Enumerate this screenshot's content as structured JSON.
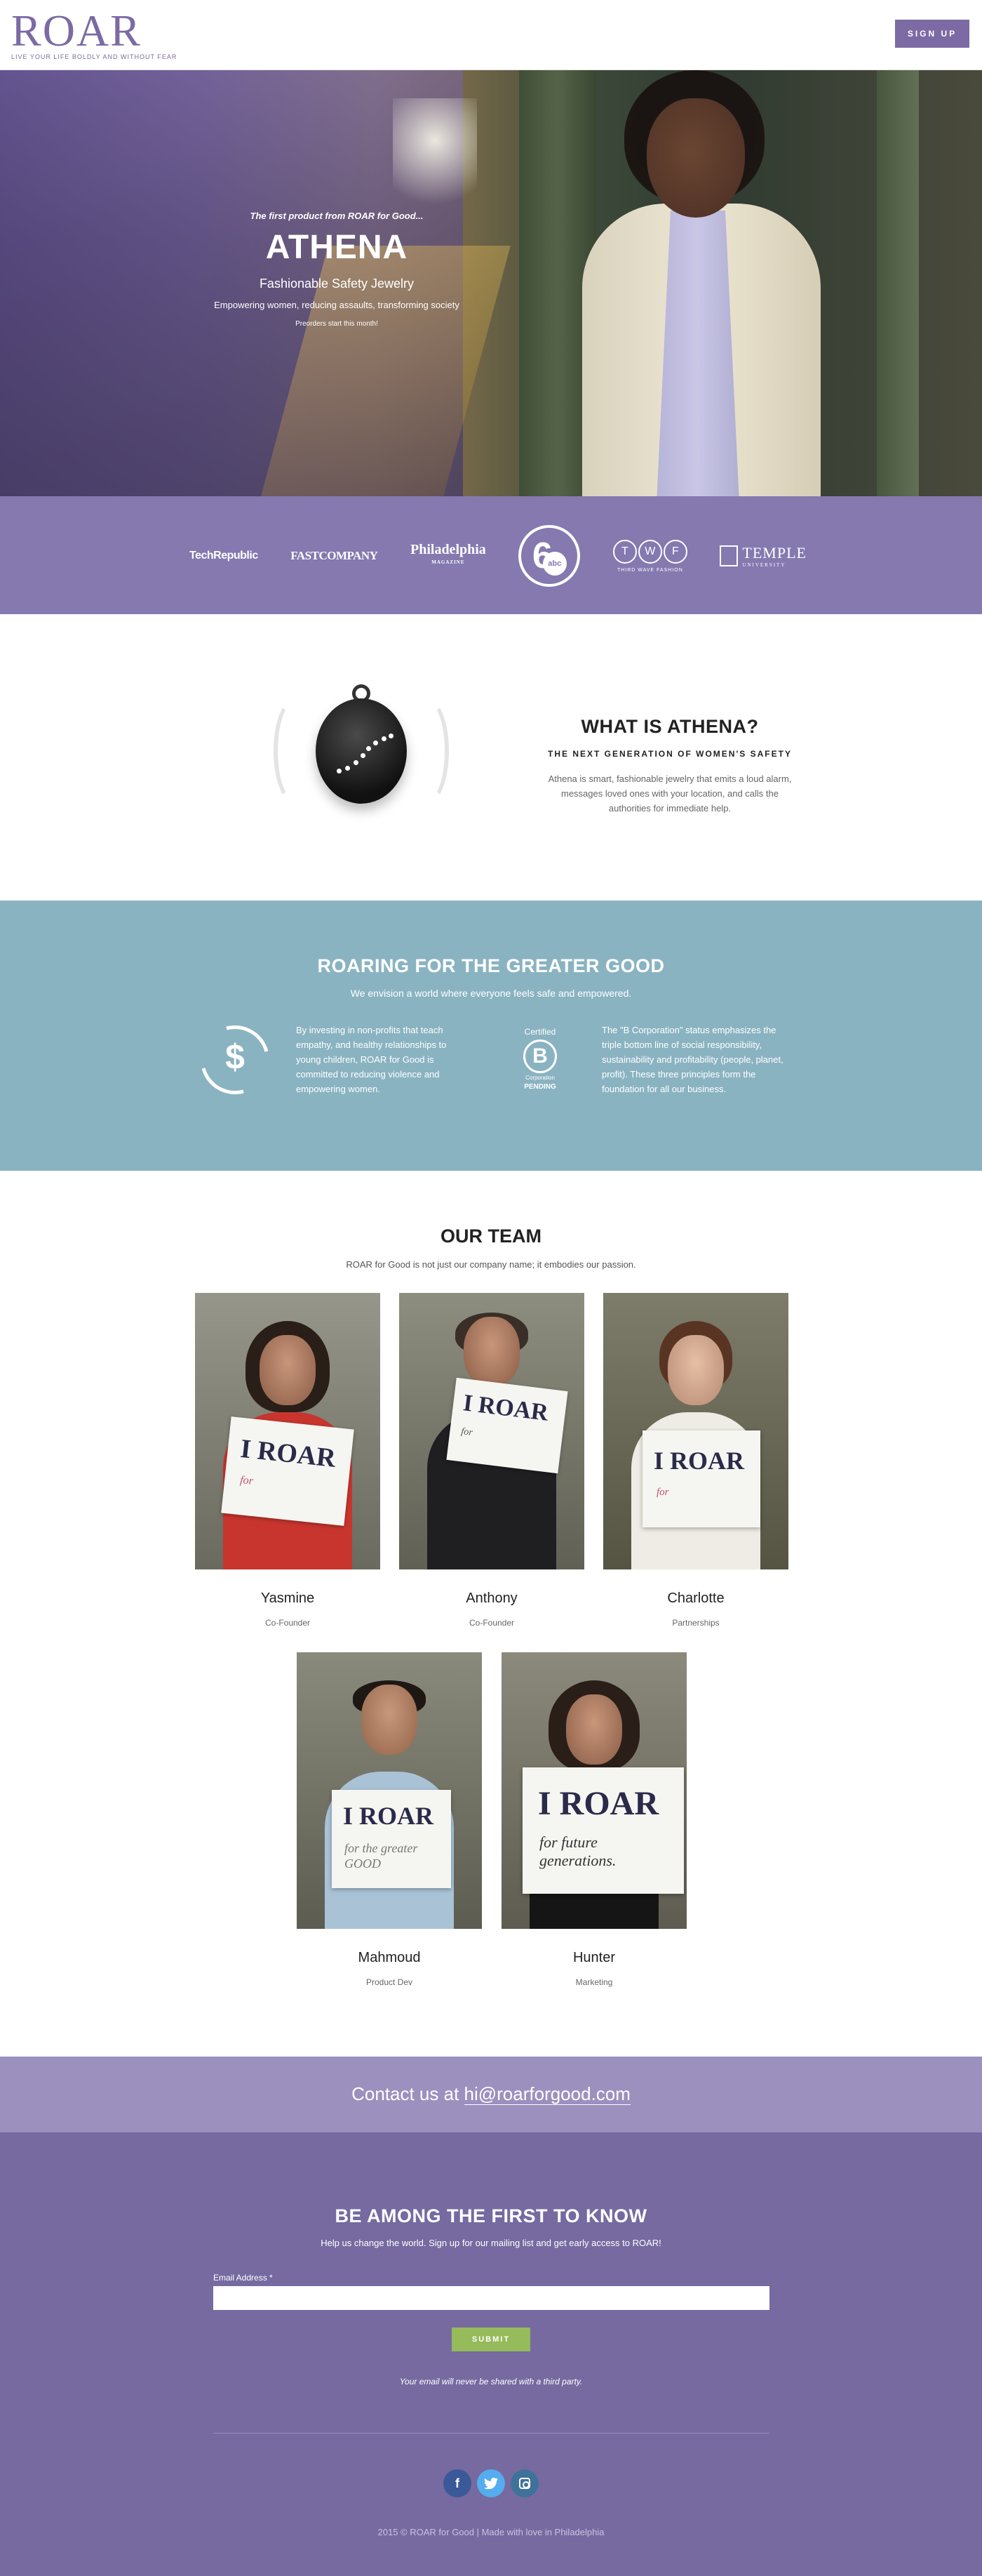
{
  "header": {
    "logo_text": "ROAR",
    "tagline": "LIVE YOUR LIFE BOLDLY AND WITHOUT FEAR",
    "signup_label": "SIGN UP"
  },
  "hero": {
    "kicker": "The first product from ROAR for Good...",
    "title": "ATHENA",
    "subtitle": "Fashionable Safety Jewelry",
    "description": "Empowering women, reducing assaults, transforming society",
    "note": "Preorders start this month!"
  },
  "press": {
    "techrepublic": "TechRepublic",
    "fastcompany": "FASTCOMPANY",
    "philadelphia": "Philadelphia",
    "philadelphia_sub": "MAGAZINE",
    "abc_number": "6",
    "abc_text": "abc",
    "twf_letters": [
      "T",
      "W",
      "F"
    ],
    "twf_label": "THIRD WAVE FASHION",
    "temple": "TEMPLE",
    "temple_sub": "UNIVERSITY"
  },
  "what": {
    "title": "WHAT IS ATHENA?",
    "subtitle": "THE NEXT GENERATION OF WOMEN'S SAFETY",
    "description": "Athena is smart, fashionable jewelry that emits a loud alarm, messages loved ones with your location, and calls the authorities for immediate help."
  },
  "good": {
    "title": "ROARING FOR THE GREATER GOOD",
    "subtitle": "We envision a world where everyone feels safe and empowered.",
    "col1": "By investing in non-profits that teach empathy, and healthy relationships to young children, ROAR for Good is committed to reducing violence and empowering women.",
    "bcorp_top": "Certified",
    "bcorp_letter": "B",
    "bcorp_mid": "Corporation",
    "bcorp_pending": "PENDING",
    "col2": "The \"B Corporation\" status emphasizes the triple bottom line of social responsibility, sustainability and profitability (people, planet, profit). These three principles form the foundation for all our business.",
    "dollar_glyph": "$"
  },
  "team": {
    "title": "OUR TEAM",
    "subtitle": "ROAR for Good is not just our company name; it embodies our passion.",
    "members": [
      {
        "name": "Yasmine",
        "role": "Co-Founder",
        "sign_roar": "I ROAR",
        "sign_for": "for"
      },
      {
        "name": "Anthony",
        "role": "Co-Founder",
        "sign_roar": "I ROAR",
        "sign_for": "for"
      },
      {
        "name": "Charlotte",
        "role": "Partnerships",
        "sign_roar": "I ROAR",
        "sign_for": "for"
      },
      {
        "name": "Mahmoud",
        "role": "Product Dev",
        "sign_roar": "I ROAR",
        "sign_for": "for the greater GOOD"
      },
      {
        "name": "Hunter",
        "role": "Marketing",
        "sign_roar": "I ROAR",
        "sign_for": "for future generations."
      }
    ]
  },
  "contact": {
    "prefix": "Contact us at ",
    "email": "hi@roarforgood.com"
  },
  "signup": {
    "title": "BE AMONG THE FIRST TO KNOW",
    "subtitle": "Help us change the world. Sign up for our mailing list and get early access to ROAR!",
    "email_label": "Email Address *",
    "email_value": "",
    "submit_label": "SUBMIT",
    "note": "Your email will never be shared with a third party.",
    "social": {
      "facebook": "f"
    },
    "footer": "2015 © ROAR for Good | Made with love in Philadelphia"
  },
  "colors": {
    "brand_purple": "#7b6aa3",
    "press_bar": "#8579b0",
    "good_teal": "#8ab3c1",
    "contact_band": "#9c90bf",
    "signup_bg": "#766aa0",
    "submit_green": "#95bb5a"
  }
}
